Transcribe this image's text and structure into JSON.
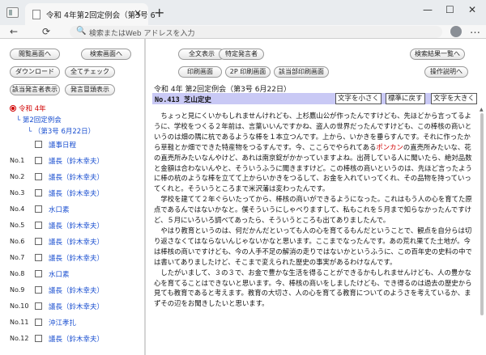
{
  "browser": {
    "tab_title": "令和 4年第2回定例会（第3号 6",
    "tab_close": "×",
    "new_tab": "+",
    "window_controls": [
      "—",
      "☐",
      "✕"
    ],
    "nav": {
      "back": "←",
      "reload": "⟳"
    },
    "address_icon": "🔍",
    "address_placeholder": "検索またはWeb アドレスを入力",
    "menu": "…"
  },
  "left": {
    "buttons": {
      "view_screen": "閲覧画面へ",
      "search_screen": "検索画面へ",
      "download": "ダウンロード",
      "check_all": "全てチェック",
      "show_speakers": "該当発言者表示",
      "show_headings": "発言冒頭表示"
    },
    "tree": {
      "era": "令和 4年",
      "session": "第2回定例会",
      "issue": "（第3号 6月22日）",
      "agenda": "議事日程"
    },
    "rows": [
      {
        "no": "No.1",
        "label": "議長（鈴木幸夫）"
      },
      {
        "no": "No.2",
        "label": "議長（鈴木幸夫）"
      },
      {
        "no": "No.3",
        "label": "議長（鈴木幸夫）"
      },
      {
        "no": "No.4",
        "label": "水口素"
      },
      {
        "no": "No.5",
        "label": "議長（鈴木幸夫）"
      },
      {
        "no": "No.6",
        "label": "議長（鈴木幸夫）"
      },
      {
        "no": "No.7",
        "label": "議長（鈴木幸夫）"
      },
      {
        "no": "No.8",
        "label": "水口素"
      },
      {
        "no": "No.9",
        "label": "議長（鈴木幸夫）"
      },
      {
        "no": "No.10",
        "label": "議長（鈴木幸夫）"
      },
      {
        "no": "No.11",
        "label": "沖江孝扎"
      },
      {
        "no": "No.12",
        "label": "議長（鈴木幸夫）"
      }
    ]
  },
  "right": {
    "buttons": {
      "show_all": "全文表示",
      "specific_speaker": "特定発言者",
      "print_screen": "印刷画面",
      "print_2p": "2P 印刷画面",
      "print_matching": "該当部印刷画面",
      "to_search_results": "検索結果一覧へ",
      "help": "操作説明へ"
    },
    "doc_title": "令和 4年 第2回定例会（第3号 6月22日）",
    "speaker": "No.413 芝山定史",
    "font_controls": {
      "smaller": "文字を小さく",
      "reset": "標準に戻す",
      "larger": "文字を大きく"
    },
    "paragraphs": [
      {
        "before": "ちょっと見にくいかもしれませんけれども、上杉鷹山公が作ったんですけども、先ほどから言ってるように、学校をつくる２年前は、言葉いいんですかね、盗人の世界だったんですけども、この棒核の商いというのは畑の隅に杭であるような棒を１本立つんです。上から、いかきを垂らすんです。それに作ったから草鞋とか畑でできた特産物をつるすんです。今、ここらでやられてある",
        "highlight": "ポンカン",
        "after": "の直売所みたいな、花の直売所みたいなんやけど、あれは南京錠がかかっていますよね。出荷している人に聞いたら、絶対品数と金額は合わないんやと、そういうふうに聞きますけど。この棒核の商いというのは、先ほど言ったように棒の杭のような棒を立てて上からいかきをつるして、お金を入れていってくれ、その品物を持っていってくれと。そういうところまで米沢藩は変わったんです。"
      },
      {
        "before": "学校を建てて２年ぐらいたってから、棒核の商いができるようになった。これはもう人の心を育てた原点であるんではないかなと。僕そういうにしゃべりますして、私もこれを５月まで知らなかったんですけど、５月にいろいろ調べてあったら、そういうところも出てありましたんで。",
        "highlight": "",
        "after": ""
      },
      {
        "before": "やはり教育というのは、何だかんだといっても人の心を育てるもんだということで、観点を自分らは切り返さなくてはならないんじゃないかなと思います。ここまでなったんです。あの荒れ果てた土地が。今は棒核の商いですけども、今の人手不足の解消の走りではないかというふうに、この百年史の史料の中では書いてありましたけど、そこまで変えられた歴史の事実があるわけなんです。",
        "highlight": "",
        "after": ""
      },
      {
        "before": "したがいまして、３の３で、お金で豊かな生活を得ることができるかもしれませんけども、人の豊かな心を育てることはできないと思います。今、棒核の商いをしましたけども、でき得るのは過去の歴史から見ても教育であると考えます。教育の大切さ、人の心を育てる教育についてのようさを考えているか、まずその辺をお聞きしたいと思います。",
        "highlight": "",
        "after": ""
      }
    ]
  }
}
